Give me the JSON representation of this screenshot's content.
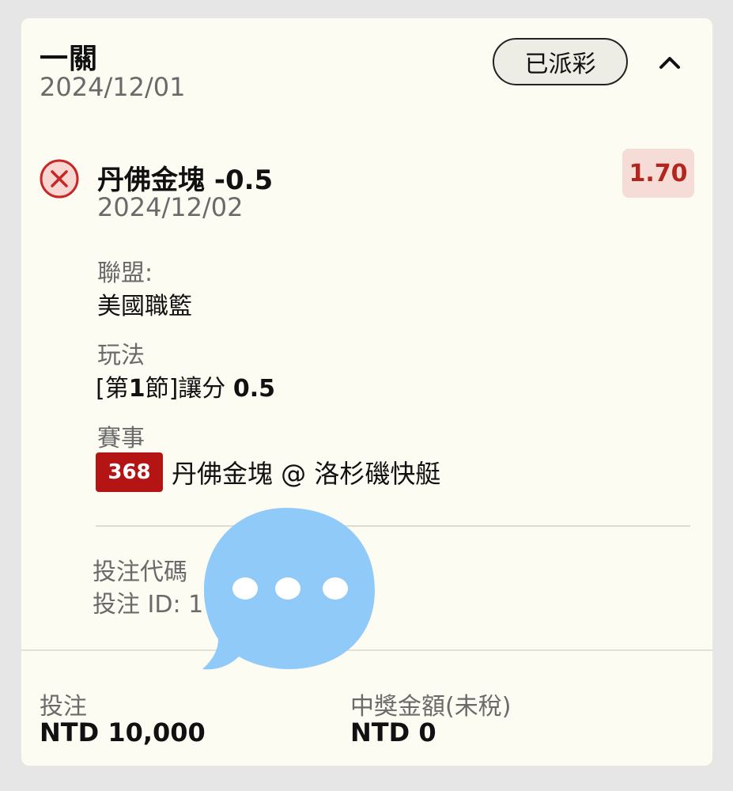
{
  "header": {
    "bet_type": "一關",
    "date": "2024/12/01",
    "status": "已派彩"
  },
  "selection": {
    "name": "丹佛金塊 -0.5",
    "date": "2024/12/02",
    "odds": "1.70",
    "result_icon": "x-circle-icon"
  },
  "details": {
    "league_label": "聯盟:",
    "league_value": "美國職籃",
    "market_label": "玩法",
    "market_value_prefix": "[第",
    "market_value_num": "1",
    "market_value_mid": "節]讓分 ",
    "market_value_line": "0.5",
    "event_label": "賽事",
    "event_id": "368",
    "event_name": "丹佛金塊 @ 洛杉磯快艇"
  },
  "reference": {
    "code_label": "投注代碼",
    "id_label": "投注 ID: 1"
  },
  "footer": {
    "stake_label": "投注",
    "stake_value": "NTD 10,000",
    "winnings_label": "中獎金額(未稅)",
    "winnings_value": "NTD 0"
  },
  "colors": {
    "card_bg": "#fdfcf3",
    "odds_text": "#b3261e",
    "odds_bg": "#f5dcd6",
    "badge_bg": "#b51414",
    "loss_icon": "#c62828",
    "overlay_bubble": "#90caf9"
  }
}
